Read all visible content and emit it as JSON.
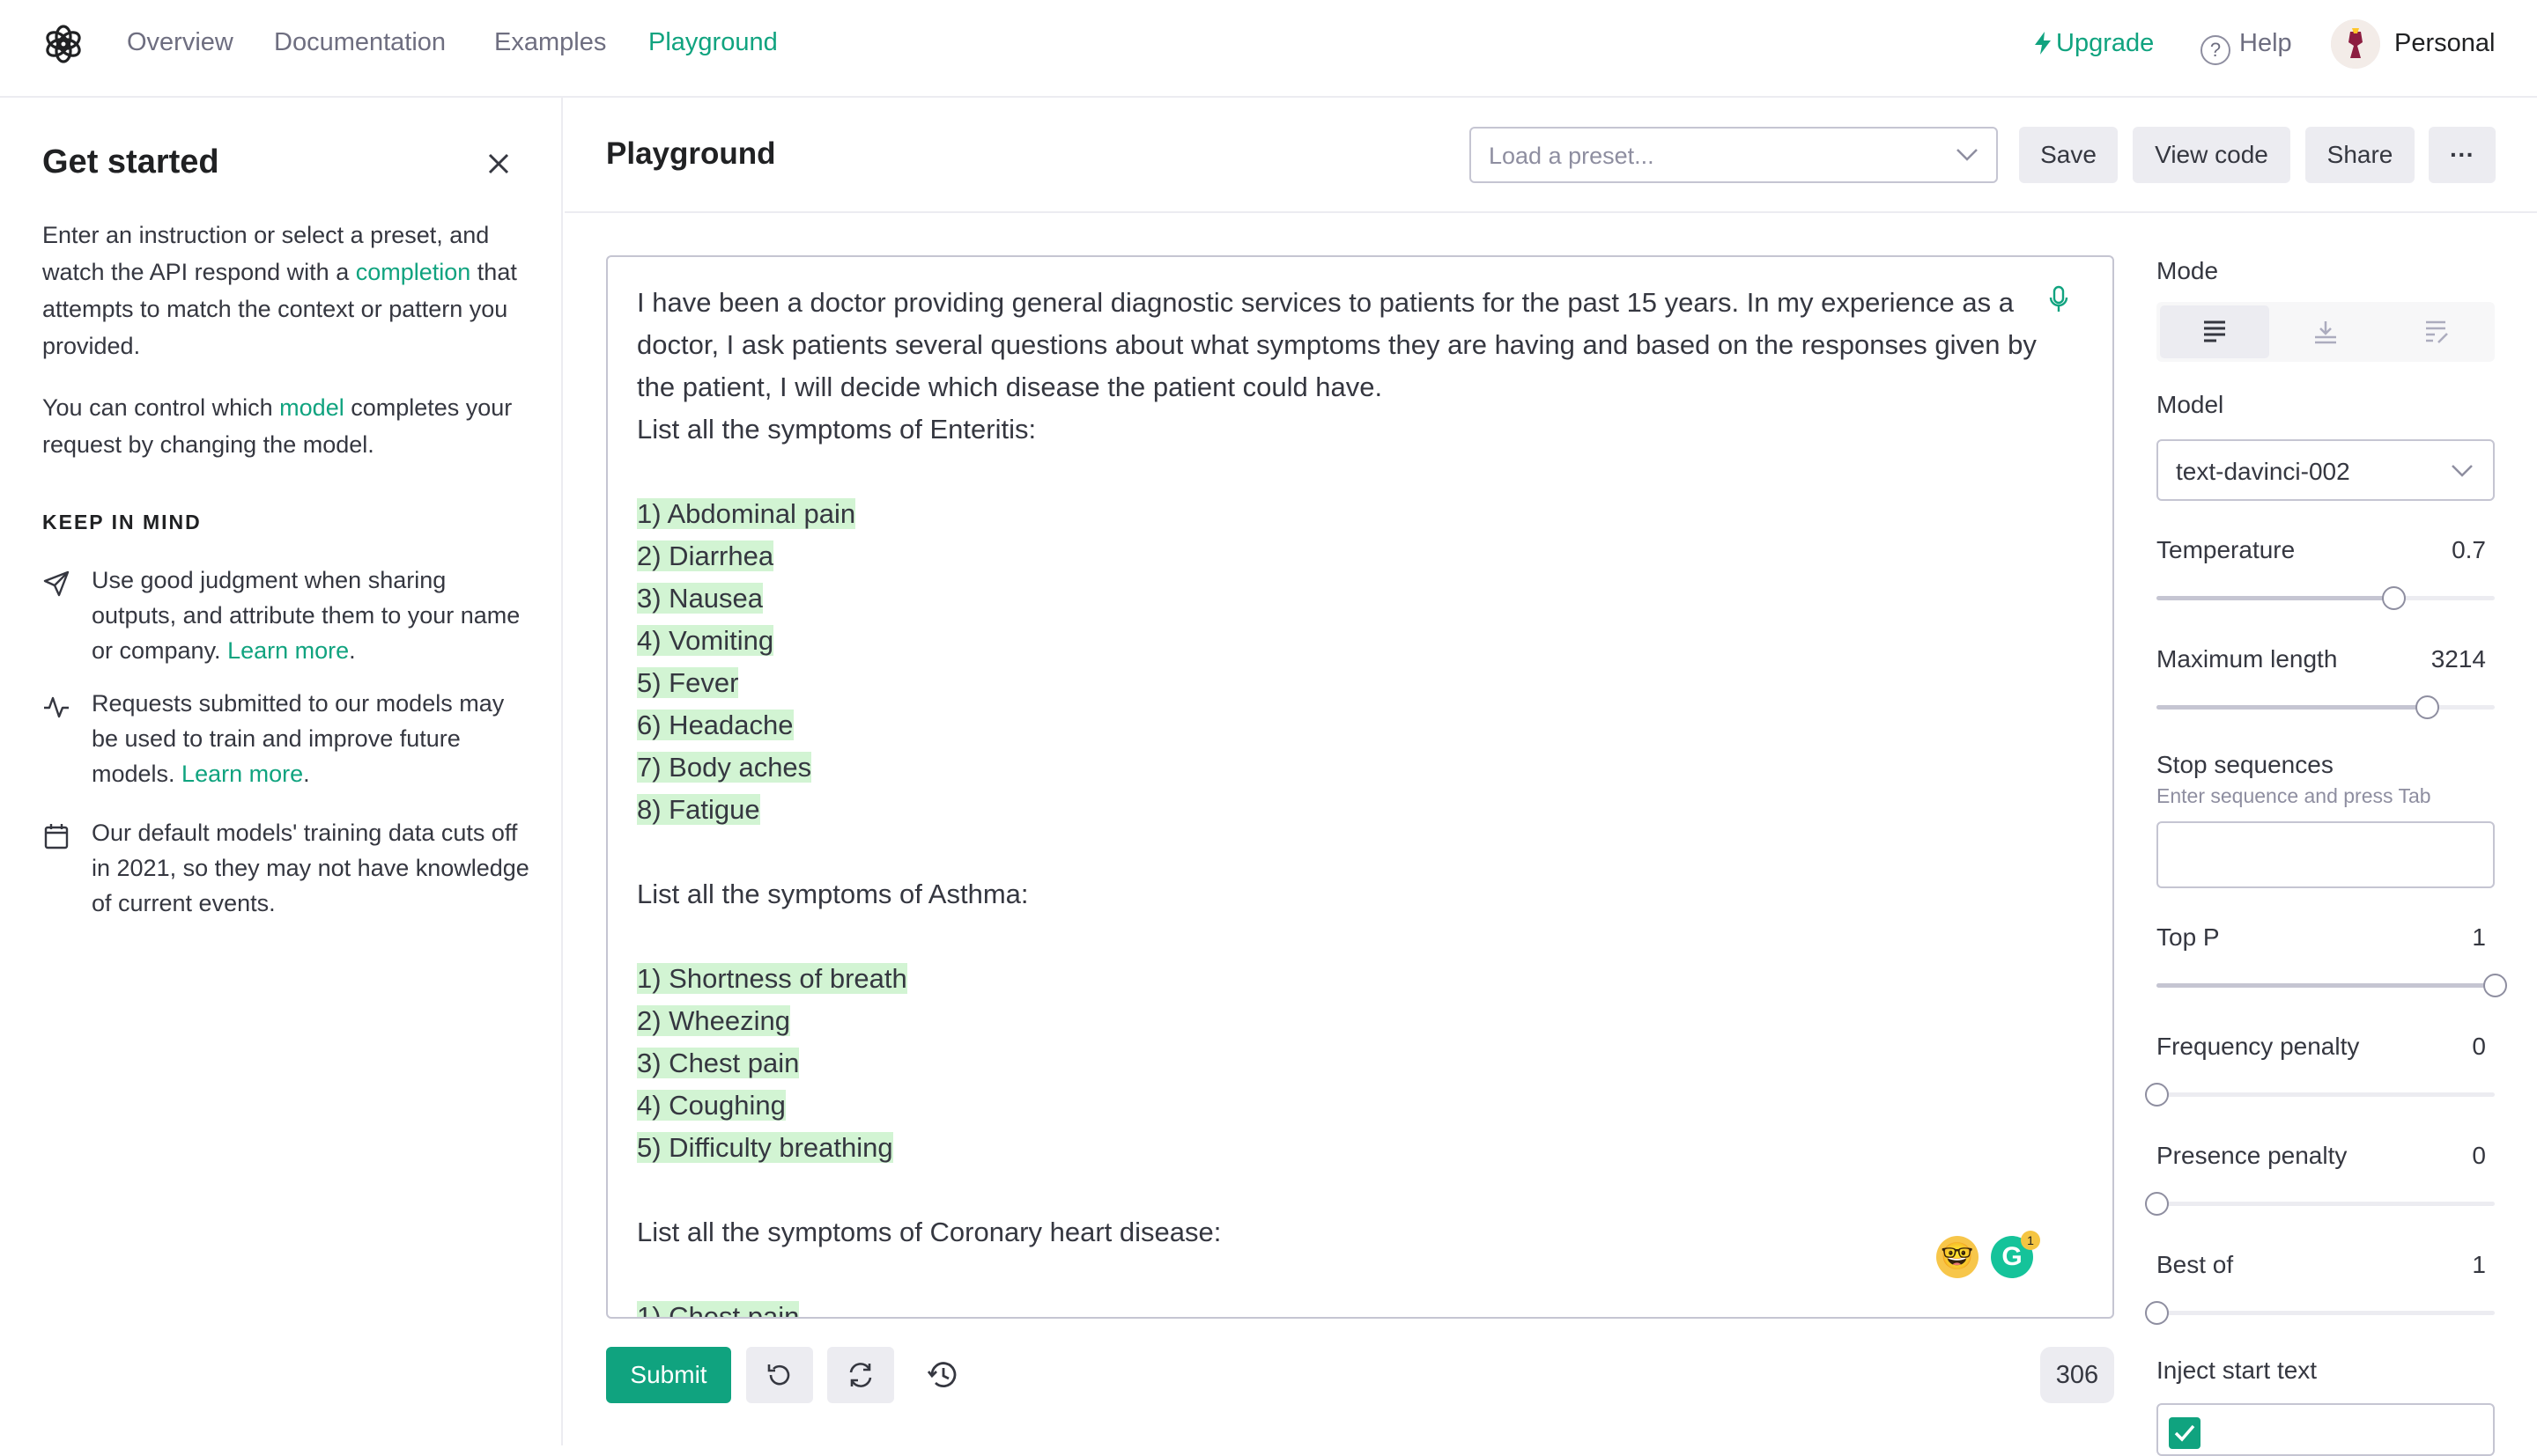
{
  "nav": {
    "links": [
      "Overview",
      "Documentation",
      "Examples",
      "Playground"
    ],
    "upgrade": "Upgrade",
    "help": "Help",
    "account": "Personal"
  },
  "sidebar": {
    "title": "Get started",
    "intro_a": "Enter an instruction or select a preset, and watch the API respond with a ",
    "intro_link": "completion",
    "intro_b": " that attempts to match the context or pattern you provided.",
    "model_a": "You can control which ",
    "model_link": "model",
    "model_b": " completes your request by changing the model.",
    "keep_in_mind": "KEEP IN MIND",
    "tips": [
      {
        "icon": "send-icon",
        "text": "Use good judgment when sharing outputs, and attribute them to your name or company. ",
        "link": "Learn more",
        "tail": "."
      },
      {
        "icon": "activity-icon",
        "text": "Requests submitted to our models may be used to train and improve future models. ",
        "link": "Learn more",
        "tail": "."
      },
      {
        "icon": "calendar-icon",
        "text": "Our default models' training data cuts off in 2021, so they may not have knowledge of current events.",
        "link": "",
        "tail": ""
      }
    ]
  },
  "header": {
    "title": "Playground",
    "preset_placeholder": "Load a preset...",
    "save": "Save",
    "view_code": "View code",
    "share": "Share",
    "more": "···"
  },
  "editor": {
    "prompt": "I have been a doctor providing general diagnostic services to patients for the past 15 years. In my experience as a doctor, I ask patients several questions about what symptoms they are having and based on the responses given by the patient, I will decide which disease the patient could have.\nList all the symptoms of Enteritis:\n",
    "enteritis": [
      "1) Abdominal pain",
      "2) Diarrhea",
      "3) Nausea",
      "4) Vomiting",
      "5) Fever",
      "6) Headache",
      "7) Body aches",
      "8) Fatigue"
    ],
    "asthma_q": "List all the symptoms of Asthma:",
    "asthma": [
      "1) Shortness of breath",
      "2) Wheezing",
      "3) Chest pain",
      "4) Coughing",
      "5) Difficulty breathing"
    ],
    "chd_q": "List all the symptoms of Coronary heart disease:",
    "chd_partial": "1) Chest pain",
    "grammarly_count": "1"
  },
  "footer": {
    "submit": "Submit",
    "token_count": "306"
  },
  "settings": {
    "mode_label": "Mode",
    "mode_selected": "complete",
    "model_label": "Model",
    "model_value": "text-davinci-002",
    "temperature": {
      "label": "Temperature",
      "value": "0.7",
      "fraction": 0.7
    },
    "max_length": {
      "label": "Maximum length",
      "value": "3214",
      "fraction": 0.8
    },
    "stop_label": "Stop sequences",
    "stop_hint": "Enter sequence and press Tab",
    "top_p": {
      "label": "Top P",
      "value": "1",
      "fraction": 1.0
    },
    "freq": {
      "label": "Frequency penalty",
      "value": "0",
      "fraction": 0.0
    },
    "presence": {
      "label": "Presence penalty",
      "value": "0",
      "fraction": 0.0
    },
    "best_of": {
      "label": "Best of",
      "value": "1",
      "fraction": 0.0
    },
    "inject_label": "Inject start text",
    "inject_checked": true
  },
  "colors": {
    "accent": "#10a37f",
    "highlight": "#d2f4d3"
  }
}
